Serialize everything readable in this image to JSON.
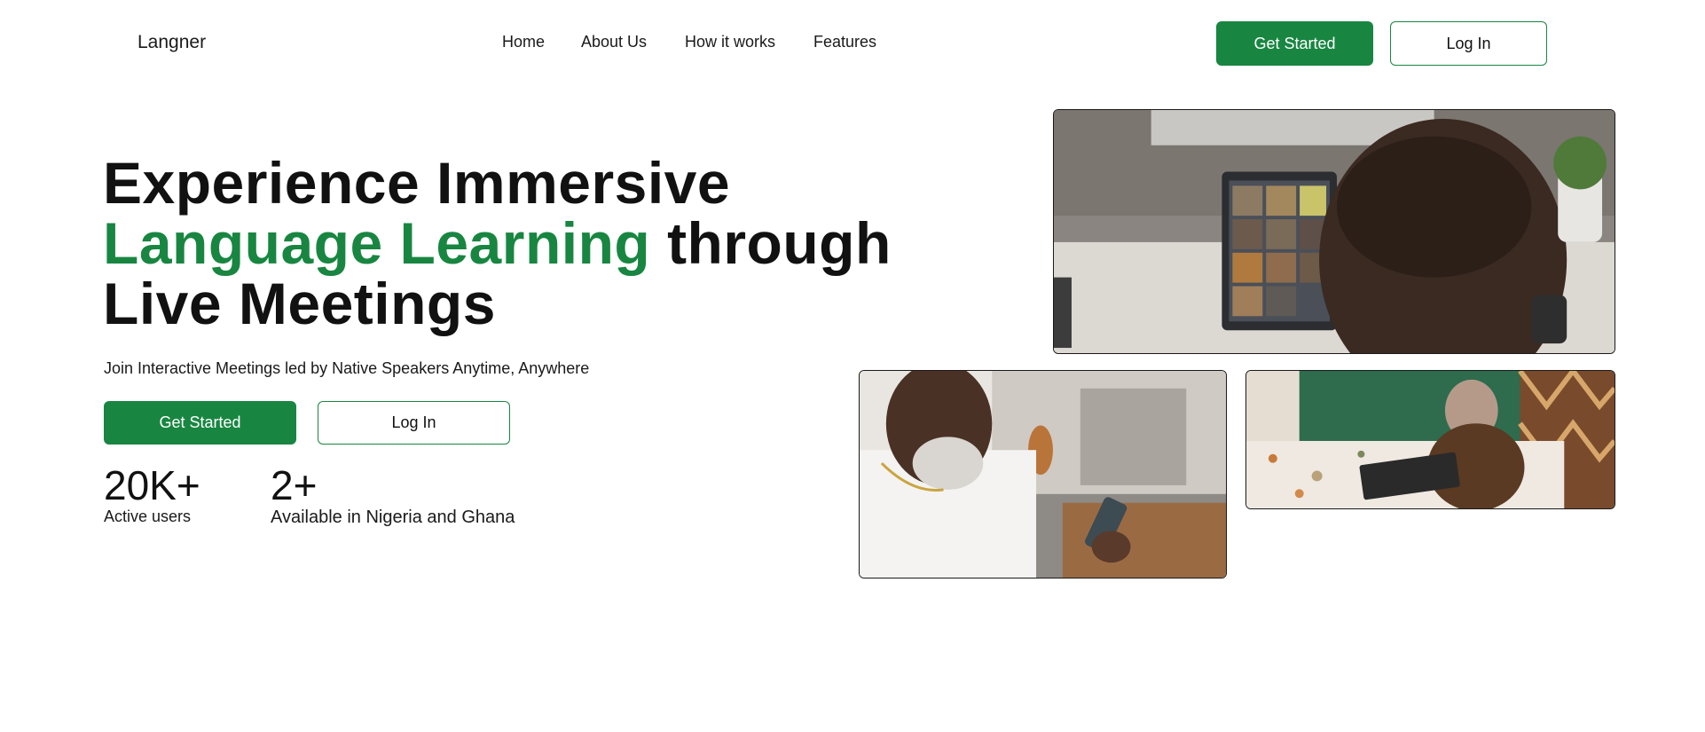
{
  "header": {
    "brand": "Langner",
    "nav": [
      {
        "label": "Home"
      },
      {
        "label": "About Us"
      },
      {
        "label": "How it works"
      },
      {
        "label": "Features"
      }
    ],
    "get_started": "Get Started",
    "login": "Log In"
  },
  "hero": {
    "title_line1": "Experience Immersive",
    "title_accent": "Language Learning",
    "title_after_accent": " through",
    "title_line3": "Live Meetings",
    "subtitle": "Join Interactive Meetings led by Native Speakers Anytime, Anywhere",
    "get_started": "Get Started",
    "login": "Log In"
  },
  "stats": [
    {
      "value": "20K+",
      "label": "Active users"
    },
    {
      "value": "2+",
      "label": "Available in Nigeria and Ghana"
    }
  ],
  "colors": {
    "accent": "#188641",
    "text": "#111111",
    "background": "#ffffff"
  }
}
